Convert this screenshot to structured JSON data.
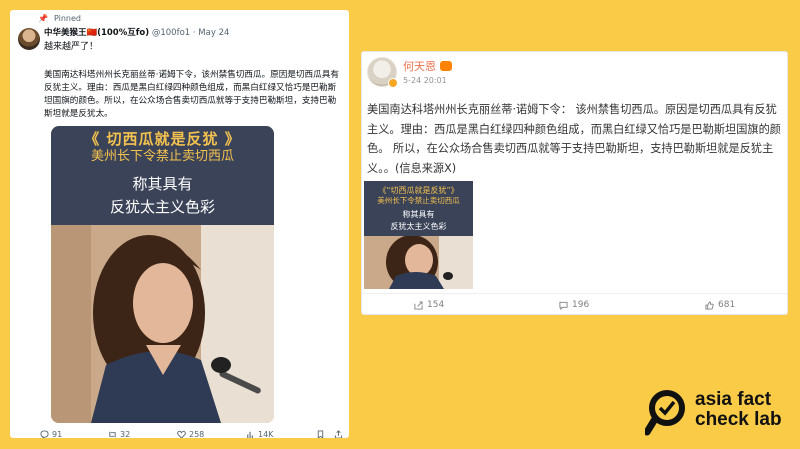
{
  "tweet": {
    "pinned_label": "Pinned",
    "display_name": "中华美猴王🇨🇳(100%互fo)",
    "handle_date": "@100fo1 · May 24",
    "first_line": "越来越严了！",
    "body": "美国南达科塔州州长克丽丝蒂·诺姆下令，该州禁售切西瓜。原因是切西瓜具有反犹主义。理由：西瓜是黑白红绿四种颜色组成，而黑白红绿又恰巧是巴勒斯坦国旗的颜色。所以，在公众场合售卖切西瓜就等于支持巴勒斯坦，支持巴勒斯坦就是反犹太。",
    "image_text": {
      "line1": "《 切西瓜就是反犹 》",
      "line2": "美州长下令禁止卖切西瓜",
      "line3": "称其具有",
      "line4": "反犹太主义色彩"
    },
    "stats": {
      "replies": "91",
      "reposts": "32",
      "likes": "258",
      "views": "14K"
    }
  },
  "weibo": {
    "name": "何天恩",
    "time": "5-24 20:01",
    "body": "美国南达科塔州州长克丽丝蒂·诺姆下令： 该州禁售切西瓜。原因是切西瓜具有反犹主义。理由：西瓜是黑白红绿四种颜色组成，而黑白红绿又恰巧是巴勒斯坦国旗的颜色。 所以，在公众场合售卖切西瓜就等于支持巴勒斯坦，支持巴勒斯坦就是反犹主义。。(信息来源X)",
    "image_text": {
      "line1": "《“切西瓜就是反犹”》",
      "line2": "美州长下令禁止卖切西瓜",
      "line3": "称其具有",
      "line4": "反犹太主义色彩"
    },
    "shares": "154",
    "comments": "196",
    "likes": "681"
  },
  "logo": {
    "line1": "asia fact",
    "line2": "check lab"
  },
  "colors": {
    "background": "#f9cb47",
    "banner": "#3b4359",
    "banner_gold": "#f4c24e",
    "weibo_name": "#eb7350"
  }
}
